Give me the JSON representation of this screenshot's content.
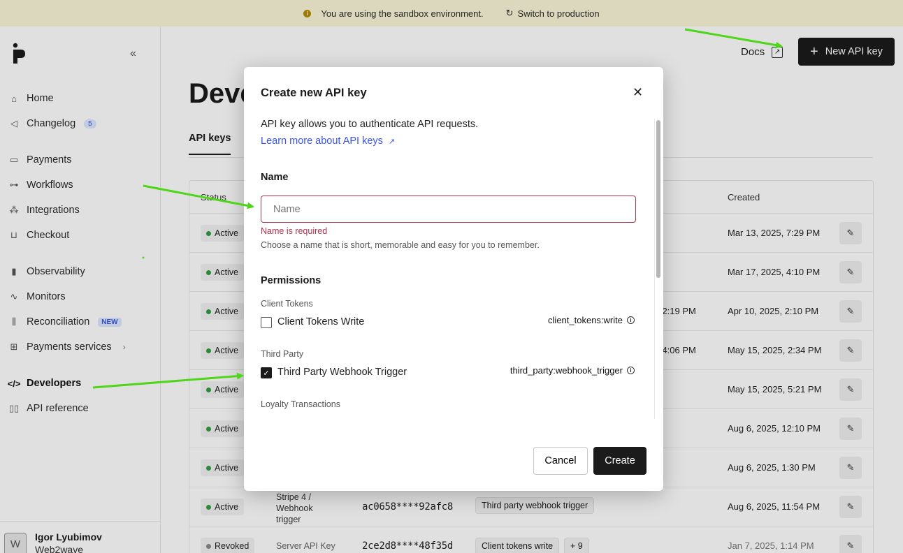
{
  "banner": {
    "message": "You are using the sandbox environment.",
    "switch_label": "Switch to production"
  },
  "sidebar": {
    "items": [
      {
        "label": "Home",
        "icon": "home-icon"
      },
      {
        "label": "Changelog",
        "icon": "megaphone-icon",
        "badge": "5"
      },
      {
        "label": "Payments",
        "icon": "card-icon"
      },
      {
        "label": "Workflows",
        "icon": "workflow-icon"
      },
      {
        "label": "Integrations",
        "icon": "integrations-icon"
      },
      {
        "label": "Checkout",
        "icon": "cart-icon"
      },
      {
        "label": "Observability",
        "icon": "chart-icon"
      },
      {
        "label": "Monitors",
        "icon": "pulse-icon"
      },
      {
        "label": "Reconciliation",
        "icon": "reconciliation-icon",
        "badge": "NEW"
      },
      {
        "label": "Payments services",
        "icon": "grid-icon"
      },
      {
        "label": "Developers",
        "icon": "code-icon"
      },
      {
        "label": "API reference",
        "icon": "book-icon"
      }
    ],
    "user": {
      "initial": "W",
      "name": "Igor Lyubimov",
      "org": "Web2wave"
    }
  },
  "header": {
    "docs_label": "Docs",
    "new_key_label": "New API key"
  },
  "page": {
    "title": "Deve",
    "tab_api_keys": "API keys"
  },
  "table": {
    "col_status": "Status",
    "col_created": "Created",
    "rows": [
      {
        "status": "Active",
        "created": "Mar 13, 2025, 7:29 PM"
      },
      {
        "status": "Active",
        "created": "Mar 17, 2025, 4:10 PM"
      },
      {
        "status": "Active",
        "updated": "5, 2:19 PM",
        "created": "Apr 10, 2025, 2:10 PM"
      },
      {
        "status": "Active",
        "updated": "5, 4:06 PM",
        "created": "May 15, 2025, 2:34 PM"
      },
      {
        "status": "Active",
        "created": "May 15, 2025, 5:21 PM"
      },
      {
        "status": "Active",
        "created": "Aug 6, 2025, 12:10 PM"
      },
      {
        "status": "Active",
        "created": "Aug 6, 2025, 1:30 PM"
      },
      {
        "status": "Active",
        "name_lines": [
          "Stripe 4 /",
          "Webhook",
          "trigger"
        ],
        "key": "ac0658****92afc8",
        "permission": "Third party webhook trigger",
        "created": "Aug 6, 2025, 11:54 PM"
      },
      {
        "status": "Revoked",
        "name": "Server API Key",
        "key": "2ce2d8****48f35d",
        "permission": "Client tokens write",
        "more": "+ 9",
        "created": "Jan 7, 2025, 1:14 PM"
      }
    ]
  },
  "modal": {
    "title": "Create new API key",
    "description": "API key allows you to authenticate API requests.",
    "learn_more": "Learn more about API keys",
    "name_label": "Name",
    "name_placeholder": "Name",
    "name_value": "",
    "error": "Name is required",
    "hint": "Choose a name that is short, memorable and easy for you to remember.",
    "permissions_title": "Permissions",
    "groups": [
      {
        "label": "Client Tokens",
        "permission": {
          "name": "Client Tokens Write",
          "scope": "client_tokens:write",
          "checked": false
        }
      },
      {
        "label": "Third Party",
        "permission": {
          "name": "Third Party Webhook Trigger",
          "scope": "third_party:webhook_trigger",
          "checked": true
        }
      },
      {
        "label": "Loyalty Transactions"
      }
    ],
    "cancel_label": "Cancel",
    "create_label": "Create"
  },
  "colors": {
    "banner_bg": "#fbf6d8",
    "primary": "#1b1b1b",
    "error": "#b3304a",
    "link": "#3b55e6",
    "annotation_arrow": "#4fd61a"
  }
}
